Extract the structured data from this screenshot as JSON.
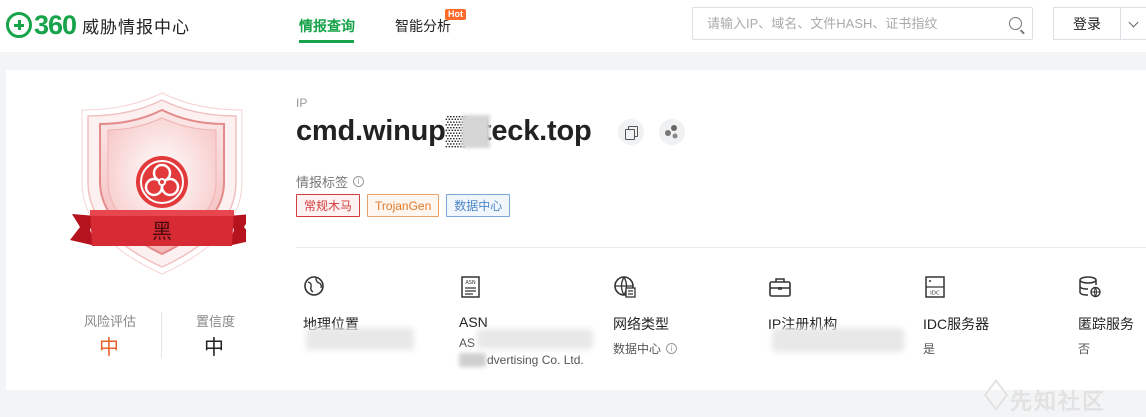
{
  "header": {
    "logo_mark": "360",
    "logo_text": "威胁情报中心",
    "nav": [
      {
        "label": "情报查询",
        "active": true
      },
      {
        "label": "智能分析",
        "active": false
      }
    ],
    "hot_badge": "Hot",
    "search": {
      "placeholder": "请输入IP、域名、文件HASH、证书指纹",
      "value": ""
    },
    "login_label": "登录"
  },
  "summary": {
    "verdict": "黑",
    "risk_label": "风险评估",
    "risk_value": "中",
    "confidence_label": "置信度",
    "confidence_value": "中"
  },
  "target": {
    "type_label": "IP",
    "domain": "cmd.winup▒ateck.top",
    "actions": [
      "copy-icon",
      "graph-icon"
    ]
  },
  "tags_section": {
    "title": "情报标签",
    "tags": [
      {
        "label": "常规木马",
        "color": "#d33c3c",
        "bg": "#fff2f2"
      },
      {
        "label": "TrojanGen",
        "color": "#e07a2a",
        "bg": "#fff6ef"
      },
      {
        "label": "数据中心",
        "color": "#4f86c6",
        "bg": "#f1f6fc"
      }
    ]
  },
  "info": [
    {
      "title": "地理位置",
      "value": "",
      "icon": "globe-icon"
    },
    {
      "title": "ASN",
      "value": "AS",
      "value2": "dvertising Co. Ltd.",
      "icon": "asn-icon"
    },
    {
      "title": "网络类型",
      "value": "数据中心",
      "icon": "network-globe-icon"
    },
    {
      "title": "IP注册机构",
      "value": "",
      "icon": "briefcase-icon"
    },
    {
      "title": "IDC服务器",
      "value": "是",
      "icon": "idc-icon"
    },
    {
      "title": "匿踪服务",
      "value": "否",
      "icon": "database-icon"
    }
  ],
  "watermark": "先知社区",
  "colors": {
    "brand": "#17a34a",
    "risk": "#e8632b",
    "danger": "#d62b35"
  }
}
